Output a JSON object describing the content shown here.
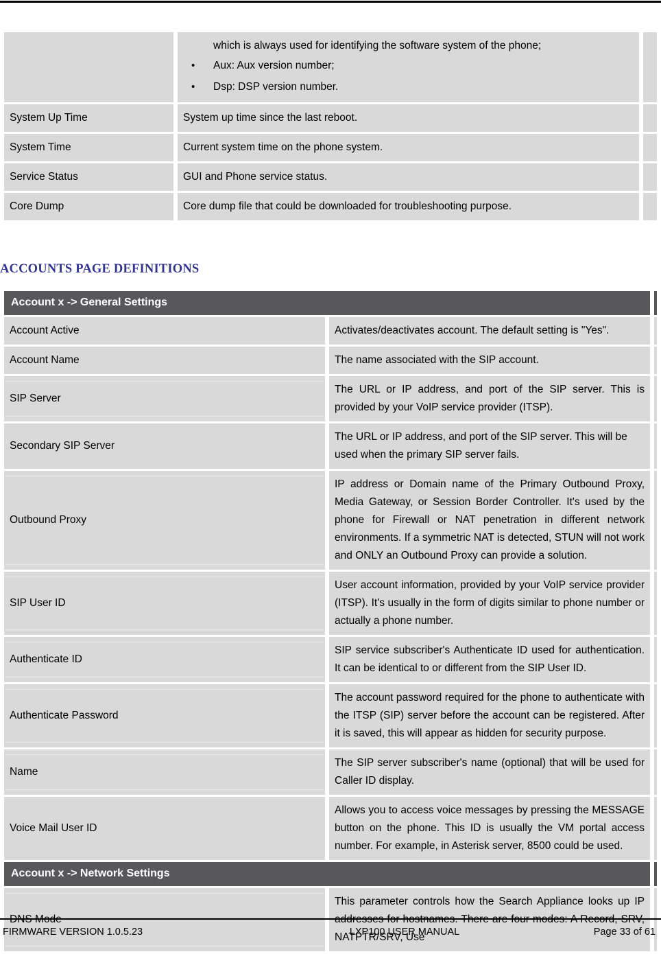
{
  "document": {
    "colors": {
      "section_bar_bg": "#58585a",
      "cell_bg": "#d9d9d9",
      "heading_color": "#33348e",
      "page_bg": "#ffffff"
    }
  },
  "status_table": {
    "continued_row": {
      "term": "",
      "continuation_line": "which is always used for identifying the software system of the phone;",
      "bullets": [
        "Aux: Aux version number;",
        "Dsp: DSP version number."
      ]
    },
    "rows": [
      {
        "term": "System Up Time",
        "desc": "System up time since the last reboot."
      },
      {
        "term": "System Time",
        "desc": "Current system time on the phone system."
      },
      {
        "term": "Service Status",
        "desc": "GUI and Phone service status."
      },
      {
        "term": "Core Dump",
        "desc": "Core dump file that could be downloaded for troubleshooting purpose."
      }
    ]
  },
  "accounts_heading": "ACCOUNTS PAGE DEFINITIONS",
  "accounts_table": {
    "section_general": "Account x -> General Settings",
    "general_rows": [
      {
        "term": "Account Active",
        "desc": "Activates/deactivates account. The default setting is \"Yes\"."
      },
      {
        "term": "Account Name",
        "desc": "The name associated with the SIP account."
      },
      {
        "term": "SIP Server",
        "desc": "The URL or IP address, and port of the SIP server. This is provided by your VoIP service provider (ITSP)."
      },
      {
        "term": "Secondary SIP Server",
        "desc": "The URL or IP address, and port of the SIP server. This will be used when the primary SIP server fails."
      },
      {
        "term": "Outbound Proxy",
        "desc": "IP address or Domain name of the Primary Outbound Proxy, Media Gateway, or Session Border Controller. It's used by the phone for Firewall or NAT penetration in different network environments. If a symmetric NAT is detected, STUN will not work and ONLY an Outbound Proxy can provide a solution."
      },
      {
        "term": "SIP User ID",
        "desc": "User account information, provided by your VoIP service provider (ITSP). It's usually in the form of digits similar to phone number or actually a phone number."
      },
      {
        "term": "Authenticate ID",
        "desc": "SIP service subscriber's Authenticate ID used for authentication. It can be identical to or different from the SIP User ID."
      },
      {
        "term": "Authenticate Password",
        "desc": "The account password required for the phone to authenticate with the ITSP (SIP) server before the account can be registered. After it is saved, this will appear as hidden for security purpose."
      },
      {
        "term": "Name",
        "desc": "The SIP server subscriber's name (optional) that will be used for Caller ID display."
      },
      {
        "term": "Voice Mail User ID",
        "desc": "Allows you to access voice messages by pressing the MESSAGE button on the phone. This ID is usually the VM portal access number. For example, in Asterisk server, 8500 could be used."
      }
    ],
    "section_network": "Account x -> Network Settings",
    "network_rows": [
      {
        "term": "DNS Mode",
        "desc": "This parameter controls how the Search Appliance looks up IP addresses for hostnames. There are four modes: A Record, SRV, NATPTR/SRV, Use"
      }
    ]
  },
  "footer": {
    "left": "FIRMWARE VERSION 1.0.5.23",
    "center": "LXP100 USER MANUAL",
    "right": "Page 33 of 61"
  }
}
